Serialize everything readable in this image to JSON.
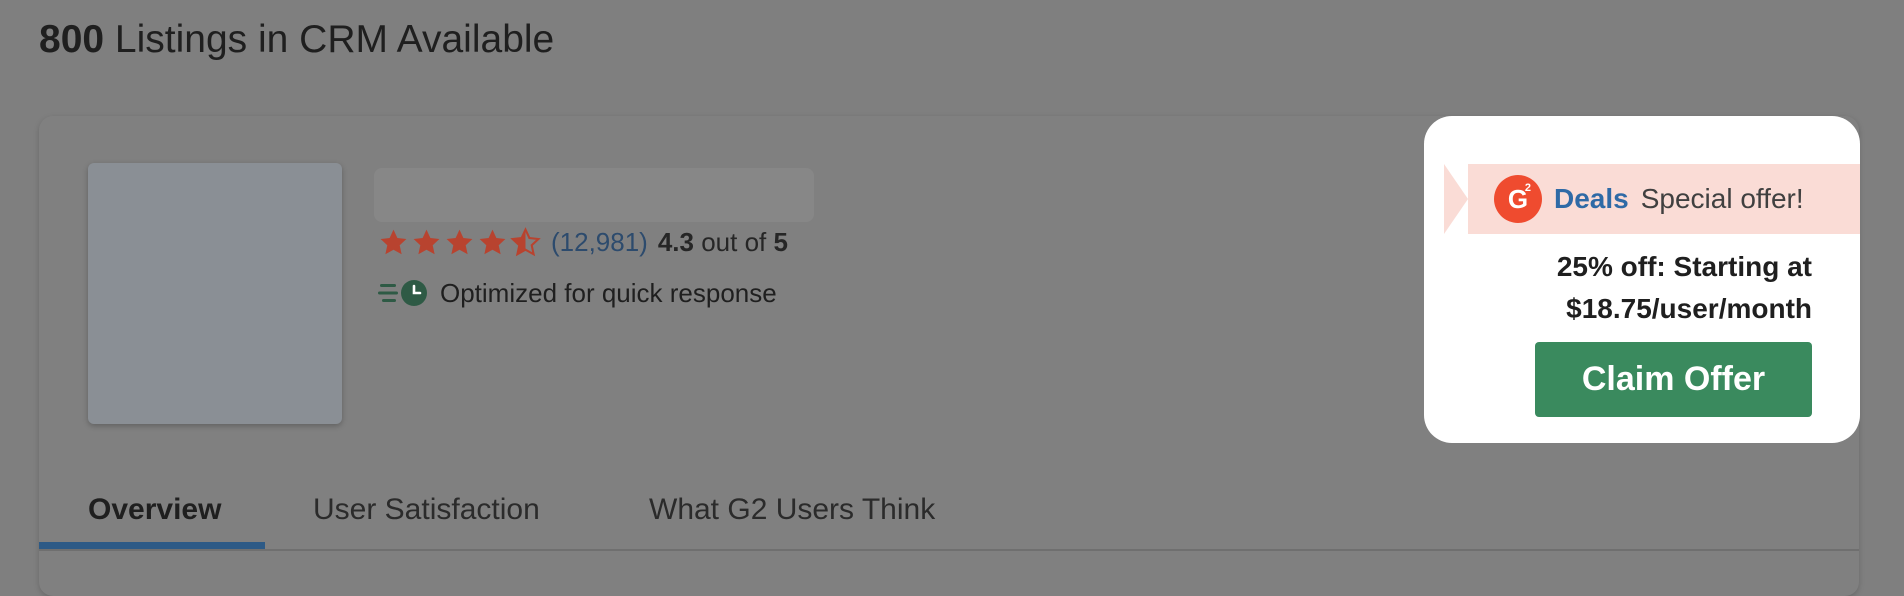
{
  "page": {
    "listings_count": "800",
    "listings_suffix": " Listings in CRM Available"
  },
  "product": {
    "review_count": "(12,981)",
    "rating_value": "4.3",
    "rating_mid": " out of ",
    "rating_max": "5",
    "rating_stars": 4.3,
    "quick_response": "Optimized for quick response",
    "star_color": "#c0392b"
  },
  "tabs": [
    {
      "label": "Overview",
      "active": true
    },
    {
      "label": "User Satisfaction",
      "active": false
    },
    {
      "label": "What G2 Users Think",
      "active": false
    }
  ],
  "deal": {
    "logo_text": "G",
    "logo_sup": "2",
    "deals_label": "Deals",
    "special_label": "Special offer!",
    "offer_line1": "25% off: Starting at",
    "offer_line2": "$18.75/user/month",
    "claim_label": "Claim Offer",
    "colors": {
      "logo": "#ef4b2f",
      "banner": "#fadcd6",
      "button": "#3a8a5e",
      "deals_text": "#2f6aa6"
    }
  }
}
